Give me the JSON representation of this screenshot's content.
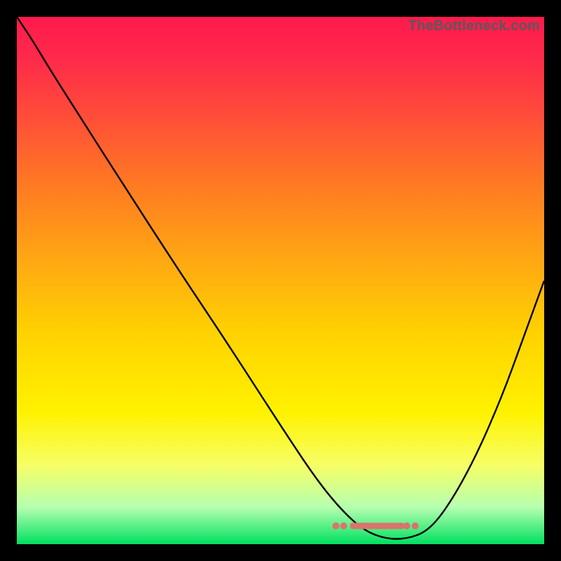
{
  "watermark": "TheBottleneck.com",
  "chart_data": {
    "type": "line",
    "title": "",
    "xlabel": "",
    "ylabel": "",
    "xlim": [
      0,
      1
    ],
    "ylim": [
      0,
      1
    ],
    "series": [
      {
        "name": "curve",
        "x": [
          0.0,
          0.03,
          0.06,
          0.12,
          0.2,
          0.3,
          0.4,
          0.5,
          0.57,
          0.62,
          0.66,
          0.7,
          0.74,
          0.78,
          0.82,
          0.87,
          0.92,
          0.96,
          1.0
        ],
        "y": [
          1.0,
          0.955,
          0.905,
          0.81,
          0.685,
          0.53,
          0.38,
          0.225,
          0.12,
          0.06,
          0.025,
          0.01,
          0.01,
          0.025,
          0.075,
          0.165,
          0.28,
          0.39,
          0.5
        ]
      }
    ],
    "highlight": {
      "left_dots_x": [
        0.605,
        0.62
      ],
      "right_dots_x": [
        0.74,
        0.755
      ],
      "bar_x_start": 0.632,
      "bar_x_end": 0.735,
      "y_level": 0.035
    },
    "gradient_stops": [
      {
        "pos": 0.0,
        "color": "#ff1a4d"
      },
      {
        "pos": 0.6,
        "color": "#ffd200"
      },
      {
        "pos": 0.93,
        "color": "#b6ffb0"
      },
      {
        "pos": 1.0,
        "color": "#00e060"
      }
    ]
  }
}
